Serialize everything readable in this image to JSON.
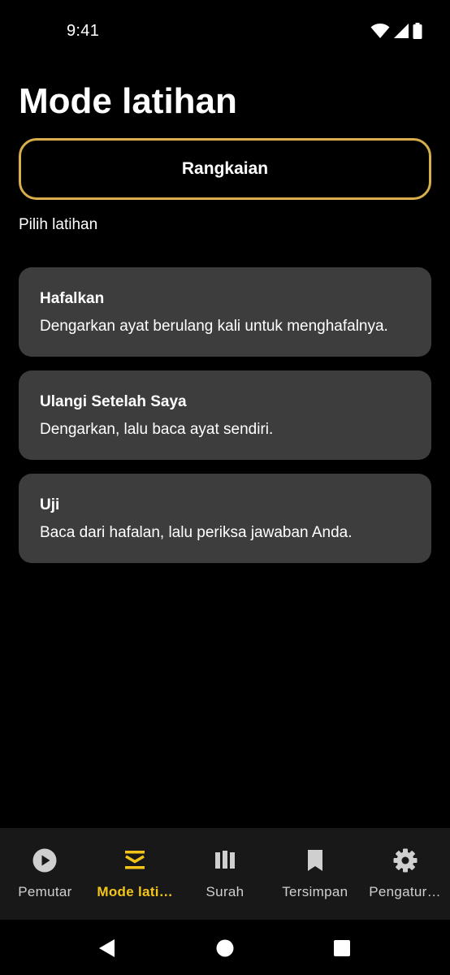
{
  "status_bar": {
    "time": "9:41",
    "icons": [
      "wifi-icon",
      "signal-icon",
      "battery-icon"
    ]
  },
  "header": {
    "title": "Mode latihan"
  },
  "sequence_button": {
    "label": "Rangkaian"
  },
  "section": {
    "label": "Pilih latihan"
  },
  "modes": [
    {
      "title": "Hafalkan",
      "description": "Dengarkan ayat berulang kali untuk menghafalnya."
    },
    {
      "title": "Ulangi Setelah Saya",
      "description": "Dengarkan, lalu baca ayat sendiri."
    },
    {
      "title": "Uji",
      "description": "Baca dari hafalan, lalu periksa jawaban Anda."
    }
  ],
  "bottom_nav": {
    "items": [
      {
        "label": "Pemutar",
        "icon": "play-circle-icon",
        "active": false
      },
      {
        "label": "Mode lati…",
        "icon": "practice-layers-icon",
        "active": true
      },
      {
        "label": "Surah",
        "icon": "library-icon",
        "active": false
      },
      {
        "label": "Tersimpan",
        "icon": "bookmark-icon",
        "active": false
      },
      {
        "label": "Pengatur…",
        "icon": "gear-icon",
        "active": false
      }
    ]
  },
  "system_nav": {
    "buttons": [
      "back-icon",
      "home-icon",
      "recents-icon"
    ]
  },
  "colors": {
    "background": "#000000",
    "accent_border": "#d8ad4b",
    "active_nav": "#f2c518",
    "card_background": "#3d3d3d",
    "nav_background": "#181818",
    "inactive_icon": "#cfcfcf"
  }
}
